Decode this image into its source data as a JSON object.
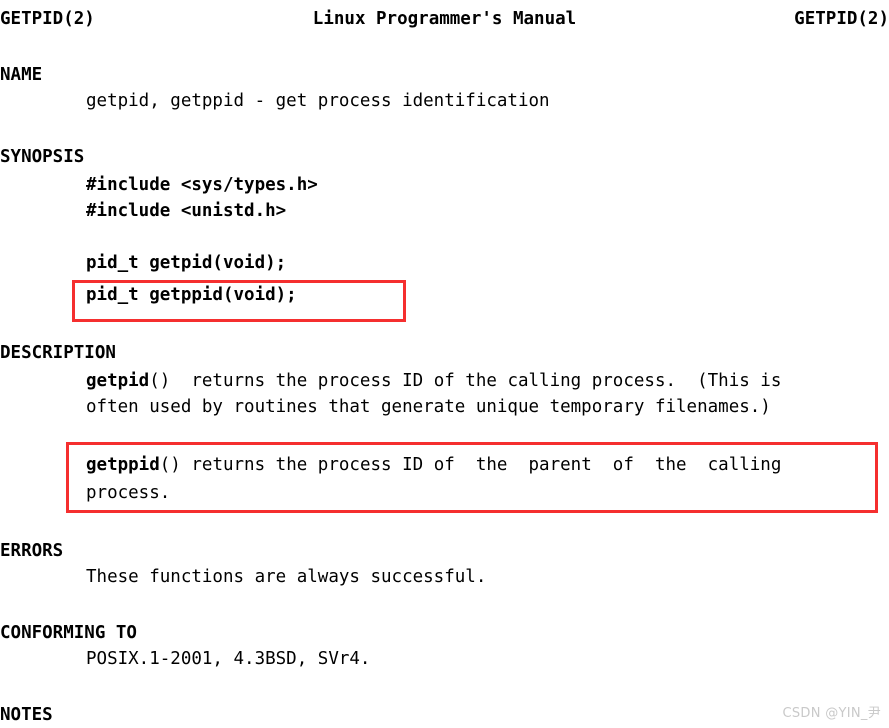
{
  "page": {
    "background_color": "#ffffff",
    "text_color": "#000000",
    "highlight_color": "#f52f2f"
  },
  "header": {
    "left": "GETPID(2)",
    "center": "Linux Programmer's Manual",
    "right": "GETPID(2)"
  },
  "sections": {
    "name": {
      "heading": "NAME",
      "body": "getpid, getppid - get process identification"
    },
    "synopsis": {
      "heading": "SYNOPSIS",
      "include_types": "#include <sys/types.h>",
      "include_unistd": "#include <unistd.h>",
      "proto_getpid": "pid_t getpid(void);",
      "proto_getppid": "pid_t getppid(void);"
    },
    "description": {
      "heading": "DESCRIPTION",
      "getpid_func": "getpid",
      "getpid_line1_rest": "()  returns the process ID of the calling process.  (This is",
      "getpid_line2": "often used by routines that generate unique temporary filenames.)",
      "getppid_func": "getppid",
      "getppid_line1_rest": "() returns the process ID of  the  parent  of  the  calling",
      "getppid_line2": "process."
    },
    "errors": {
      "heading": "ERRORS",
      "body": "These functions are always successful."
    },
    "conforming_to": {
      "heading": "CONFORMING TO",
      "body": "POSIX.1-2001, 4.3BSD, SVr4."
    },
    "notes": {
      "heading": "NOTES"
    }
  },
  "annotations": {
    "synopsis_box_label": "highlight-getppid-prototype",
    "description_box_label": "highlight-getppid-description"
  },
  "watermark": {
    "text": "CSDN @YIN_尹"
  }
}
